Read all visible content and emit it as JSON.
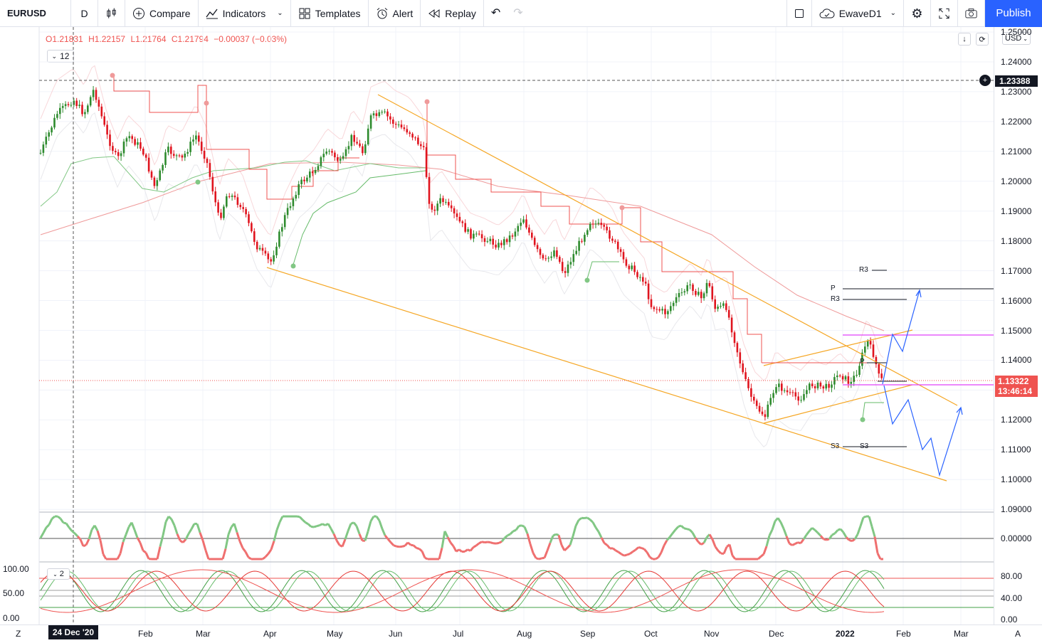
{
  "toolbar": {
    "symbol": "EURUSD",
    "interval": "D",
    "compare": "Compare",
    "indicators": "Indicators",
    "templates": "Templates",
    "alert": "Alert",
    "replay": "Replay",
    "layout_name": "EwaveD1",
    "publish": "Publish"
  },
  "legend": {
    "open": "O1.21831",
    "high": "H1.22157",
    "low": "L1.21764",
    "close": "C1.21794",
    "change": "−0.00037 (−0.03%)",
    "badge": "12",
    "osc_badge": "2"
  },
  "price_scale": {
    "currency": "USD",
    "labels": [
      "1.25000",
      "1.24000",
      "1.23000",
      "1.22000",
      "1.21000",
      "1.20000",
      "1.19000",
      "1.18000",
      "1.17000",
      "1.16000",
      "1.15000",
      "1.14000",
      "1.13000",
      "1.12000",
      "1.11000",
      "1.10000",
      "1.09000"
    ],
    "crosshair_price": "1.23388",
    "last_price": "1.13322",
    "countdown": "13:46:14",
    "osc1_label": "0.00000",
    "osc2_labels": [
      "80.00",
      "40.00",
      "0.00"
    ],
    "osc2_left_labels": [
      "100.00",
      "50.00",
      "0.00"
    ]
  },
  "time_axis": {
    "labels": [
      "Feb",
      "Mar",
      "Apr",
      "May",
      "Jun",
      "Jul",
      "Aug",
      "Sep",
      "Oct",
      "Nov",
      "Dec",
      "2022",
      "Feb",
      "Mar"
    ],
    "crosshair_date": "24 Dec '20",
    "left_btn": "Z",
    "right_btn": "A"
  },
  "pivot_labels": {
    "r3_top": "R3",
    "p": "P",
    "r3": "R3",
    "p_small": "P",
    "s3_left": "S3",
    "s3_right": "S3"
  },
  "colors": {
    "up": "#26a69a",
    "down": "#ef5350",
    "accent": "#2962ff",
    "candle_up": "#2e8b2e",
    "candle_down": "#e0141e",
    "trend": "#f5a623",
    "magenta": "#e040fb",
    "projection": "#2962ff"
  }
}
